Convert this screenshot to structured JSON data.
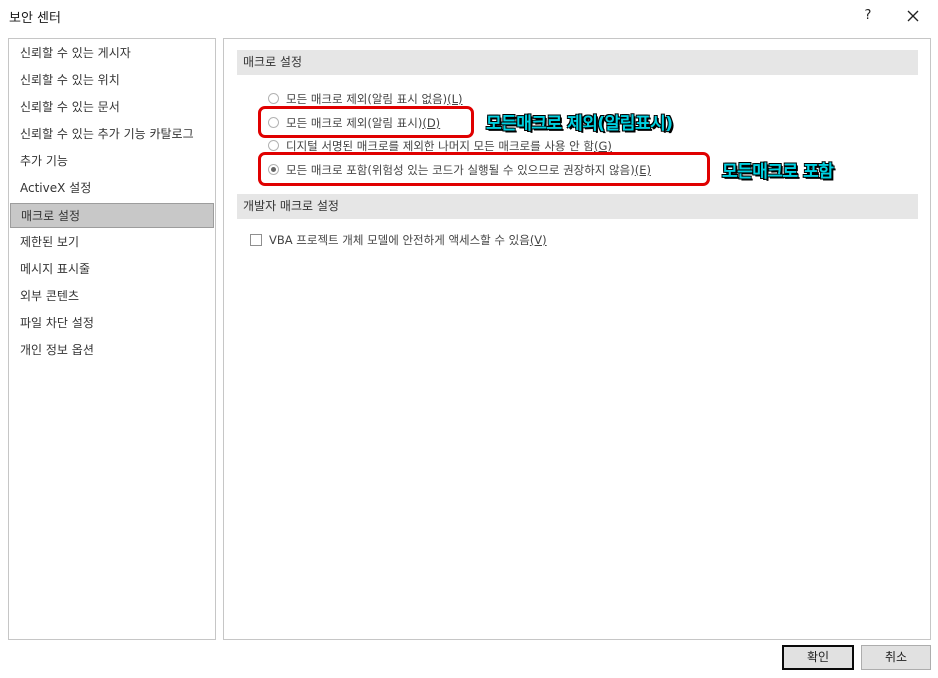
{
  "window": {
    "title": "보안 센터",
    "help_label": "?"
  },
  "sidebar": {
    "items": [
      {
        "label": "신뢰할 수 있는 게시자"
      },
      {
        "label": "신뢰할 수 있는 위치"
      },
      {
        "label": "신뢰할 수 있는 문서"
      },
      {
        "label": "신뢰할 수 있는 추가 기능 카탈로그"
      },
      {
        "label": "추가 기능"
      },
      {
        "label": "ActiveX 설정"
      },
      {
        "label": "매크로 설정"
      },
      {
        "label": "제한된 보기"
      },
      {
        "label": "메시지 표시줄"
      },
      {
        "label": "외부 콘텐츠"
      },
      {
        "label": "파일 차단 설정"
      },
      {
        "label": "개인 정보 옵션"
      }
    ],
    "selected": "매크로 설정"
  },
  "macro_settings": {
    "header": "매크로 설정",
    "options": [
      {
        "text": "모든 매크로 제외(알림 표시 없음)",
        "key": "(L)",
        "checked": false
      },
      {
        "text": "모든 매크로 제외(알림 표시)",
        "key": "(D)",
        "checked": false
      },
      {
        "text": "디지털 서명된 매크로를 제외한 나머지 모든 매크로를 사용 안 함",
        "key": "(G)",
        "checked": false
      },
      {
        "text": "모든 매크로 포함(위험성 있는 코드가 실행될 수 있으므로 권장하지 않음)",
        "key": "(E)",
        "checked": true
      }
    ]
  },
  "developer_settings": {
    "header": "개발자 매크로 설정",
    "checkbox": {
      "text": "VBA 프로젝트 개체 모델에 안전하게 액세스할 수 있음",
      "key": "(V)",
      "checked": false
    }
  },
  "annotations": {
    "disable_with_notification": "모든매크로 제외(알림표시)",
    "enable_all": "모든매크로 포함"
  },
  "footer": {
    "ok_label": "확인",
    "cancel_label": "취소"
  },
  "colors": {
    "highlight": "#e00000",
    "annotation_text": "#00d0e0"
  }
}
